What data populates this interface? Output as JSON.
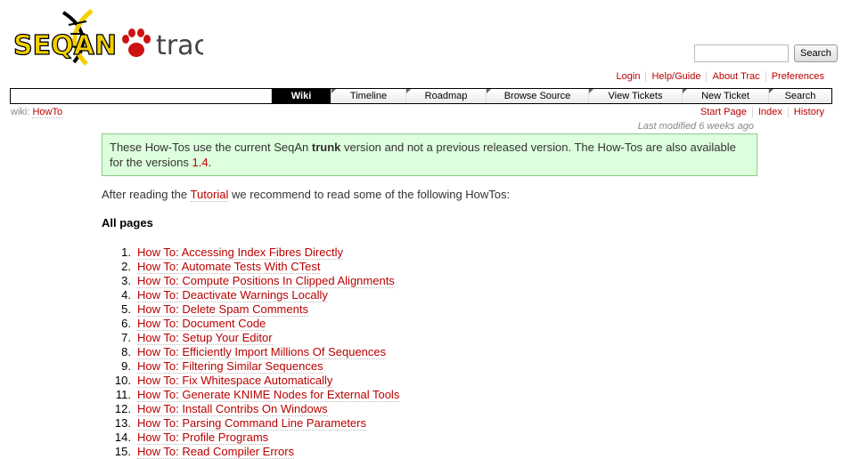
{
  "logo": {
    "text_left": "SEQAN",
    "text_right": "trac"
  },
  "search": {
    "placeholder": "",
    "button_label": "Search"
  },
  "metanav": [
    "Login",
    "Help/Guide",
    "About Trac",
    "Preferences"
  ],
  "mainnav": [
    "Wiki",
    "Timeline",
    "Roadmap",
    "Browse Source",
    "View Tickets",
    "New Ticket",
    "Search"
  ],
  "mainnav_active": "Wiki",
  "breadcrumb": {
    "prefix": "wiki:",
    "page": "HowTo"
  },
  "ctxtnav": [
    "Start Page",
    "Index",
    "History"
  ],
  "last_modified": "Last modified 6 weeks ago",
  "notice": {
    "part1": "These How-Tos use the current SeqAn ",
    "bold": "trunk",
    "part2": " version and not a previous released version. The How-Tos are also available for the versions ",
    "link": "1.4",
    "part3": "."
  },
  "intro": {
    "before": "After reading the ",
    "link": "Tutorial",
    "after": " we recommend to read some of the following HowTos:"
  },
  "section_heading": "All pages",
  "pages": [
    "How To: Accessing Index Fibres Directly",
    "How To: Automate Tests With CTest",
    "How To: Compute Positions In Clipped Alignments",
    "How To: Deactivate Warnings Locally",
    "How To: Delete Spam Comments",
    "How To: Document Code",
    "How To: Setup Your Editor",
    "How To: Efficiently Import Millions Of Sequences",
    "How To: Filtering Similar Sequences",
    "How To: Fix Whitespace Automatically",
    "How To: Generate KNIME Nodes for External Tools",
    "How To: Install Contribs On Windows",
    "How To: Parsing Command Line Parameters",
    "How To: Profile Programs",
    "How To: Read Compiler Errors"
  ],
  "colors": {
    "link": "#bb0000",
    "notice_bg": "#ddffdd",
    "notice_border": "#88cc88",
    "logo_yellow": "#f2d000",
    "logo_red": "#cc1111"
  }
}
